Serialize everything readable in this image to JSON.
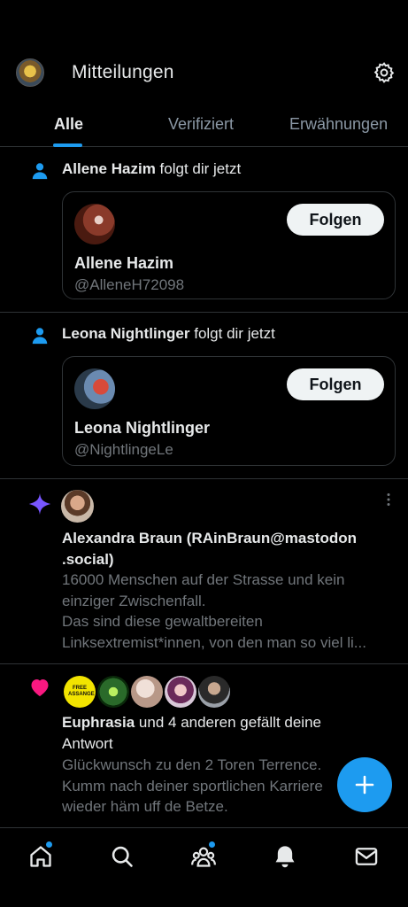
{
  "header": {
    "title": "Mitteilungen"
  },
  "tabs": [
    {
      "label": "Alle",
      "active": true
    },
    {
      "label": "Verifiziert",
      "active": false
    },
    {
      "label": "Erwähnungen",
      "active": false
    }
  ],
  "follows": [
    {
      "name": "Allene Hazim",
      "action": " folgt dir jetzt",
      "card_name": "Allene Hazim",
      "handle": "@AlleneH72098",
      "button": "Folgen"
    },
    {
      "name": "Leona Nightlinger",
      "action": " folgt dir jetzt",
      "card_name": "Leona Nightlinger",
      "handle": "@NightlingeLe",
      "button": "Folgen"
    }
  ],
  "post": {
    "author_line1": "Alexandra Braun (RAinBraun@mastodon",
    "author_line2": ".social)",
    "lines": [
      "16000 Menschen auf der Strasse und kein",
      "einziger Zwischenfall.",
      "Das sind diese gewaltbereiten",
      "Linksextremist*innen, von den man so viel li..."
    ]
  },
  "likes": {
    "avatar_badge": "FREE ASSANGE",
    "name": "Euphrasia",
    "action_line1": " und 4 anderen gefällt deine",
    "action_line2": "Antwort",
    "lines": [
      "Glückwunsch zu den 2 Toren Terrence.",
      "Kumm nach deiner sportlichen Karriere",
      "wieder häm uff de Betze."
    ]
  },
  "colors": {
    "accent": "#1d9bf0",
    "like": "#f91880",
    "spark": "#7856ff",
    "follow_icon": "#1d9bf0"
  },
  "icons": [
    "gear-icon",
    "person-icon",
    "sparkle-icon",
    "heart-icon",
    "plus-icon",
    "home-icon",
    "search-icon",
    "communities-icon",
    "bell-icon",
    "mail-icon"
  ]
}
